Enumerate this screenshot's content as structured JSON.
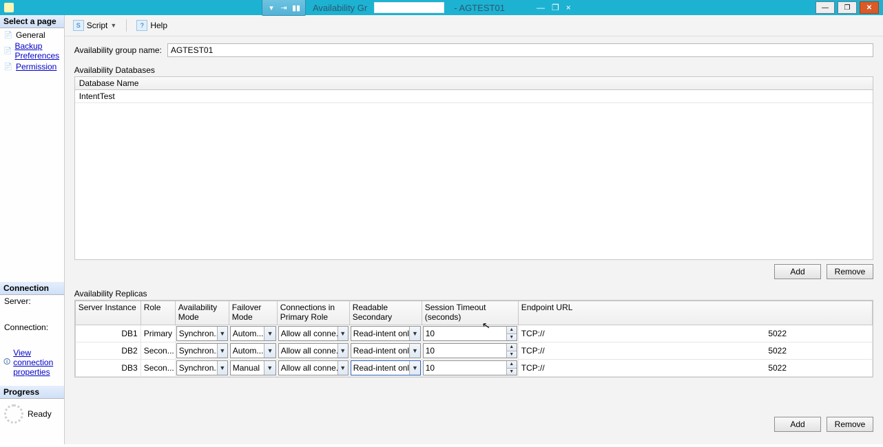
{
  "titlebar": {
    "title_left": "Availability Gr",
    "title_right": "- AGTEST01",
    "min": "—",
    "restore": "❐",
    "close": "✕"
  },
  "toolbar": {
    "script_label": "Script",
    "help_label": "Help"
  },
  "sidebar": {
    "header_pages": "Select a page",
    "items": [
      {
        "label": "General",
        "current": true
      },
      {
        "label": "Backup Preferences",
        "current": false
      },
      {
        "label": "Permission",
        "current": false
      }
    ],
    "header_conn": "Connection",
    "server_label": "Server:",
    "server_value": "",
    "connection_label": "Connection:",
    "connection_value": "",
    "view_conn": "View connection properties",
    "header_progress": "Progress",
    "progress_status": "Ready"
  },
  "main": {
    "group_name_label": "Availability group name:",
    "group_name_value": "AGTEST01",
    "databases_label": "Availability Databases",
    "db_col": "Database Name",
    "databases": [
      "IntentTest"
    ],
    "btn_add": "Add",
    "btn_remove": "Remove",
    "replicas_label": "Availability Replicas",
    "replica_cols": {
      "server": "Server Instance",
      "role": "Role",
      "availmode": "Availability Mode",
      "failmode": "Failover Mode",
      "connprim": "Connections in Primary Role",
      "readsec": "Readable Secondary",
      "timeout": "Session Timeout (seconds)",
      "endpoint": "Endpoint URL"
    },
    "replicas": [
      {
        "server": "DB1",
        "role": "Primary",
        "availmode": "Synchron...",
        "failmode": "Autom...",
        "connprim": "Allow all conne...",
        "readsec": "Read-intent only",
        "timeout": "10",
        "endpoint_host": "TCP://",
        "endpoint_port": "5022"
      },
      {
        "server": "DB2",
        "role": "Secon...",
        "availmode": "Synchron...",
        "failmode": "Autom...",
        "connprim": "Allow all conne...",
        "readsec": "Read-intent only",
        "timeout": "10",
        "endpoint_host": "TCP://",
        "endpoint_port": "5022"
      },
      {
        "server": "DB3",
        "role": "Secon...",
        "availmode": "Synchron...",
        "failmode": "Manual",
        "connprim": "Allow all conne...",
        "readsec": "Read-intent only",
        "timeout": "10",
        "endpoint_host": "TCP://",
        "endpoint_port": "5022"
      }
    ]
  }
}
